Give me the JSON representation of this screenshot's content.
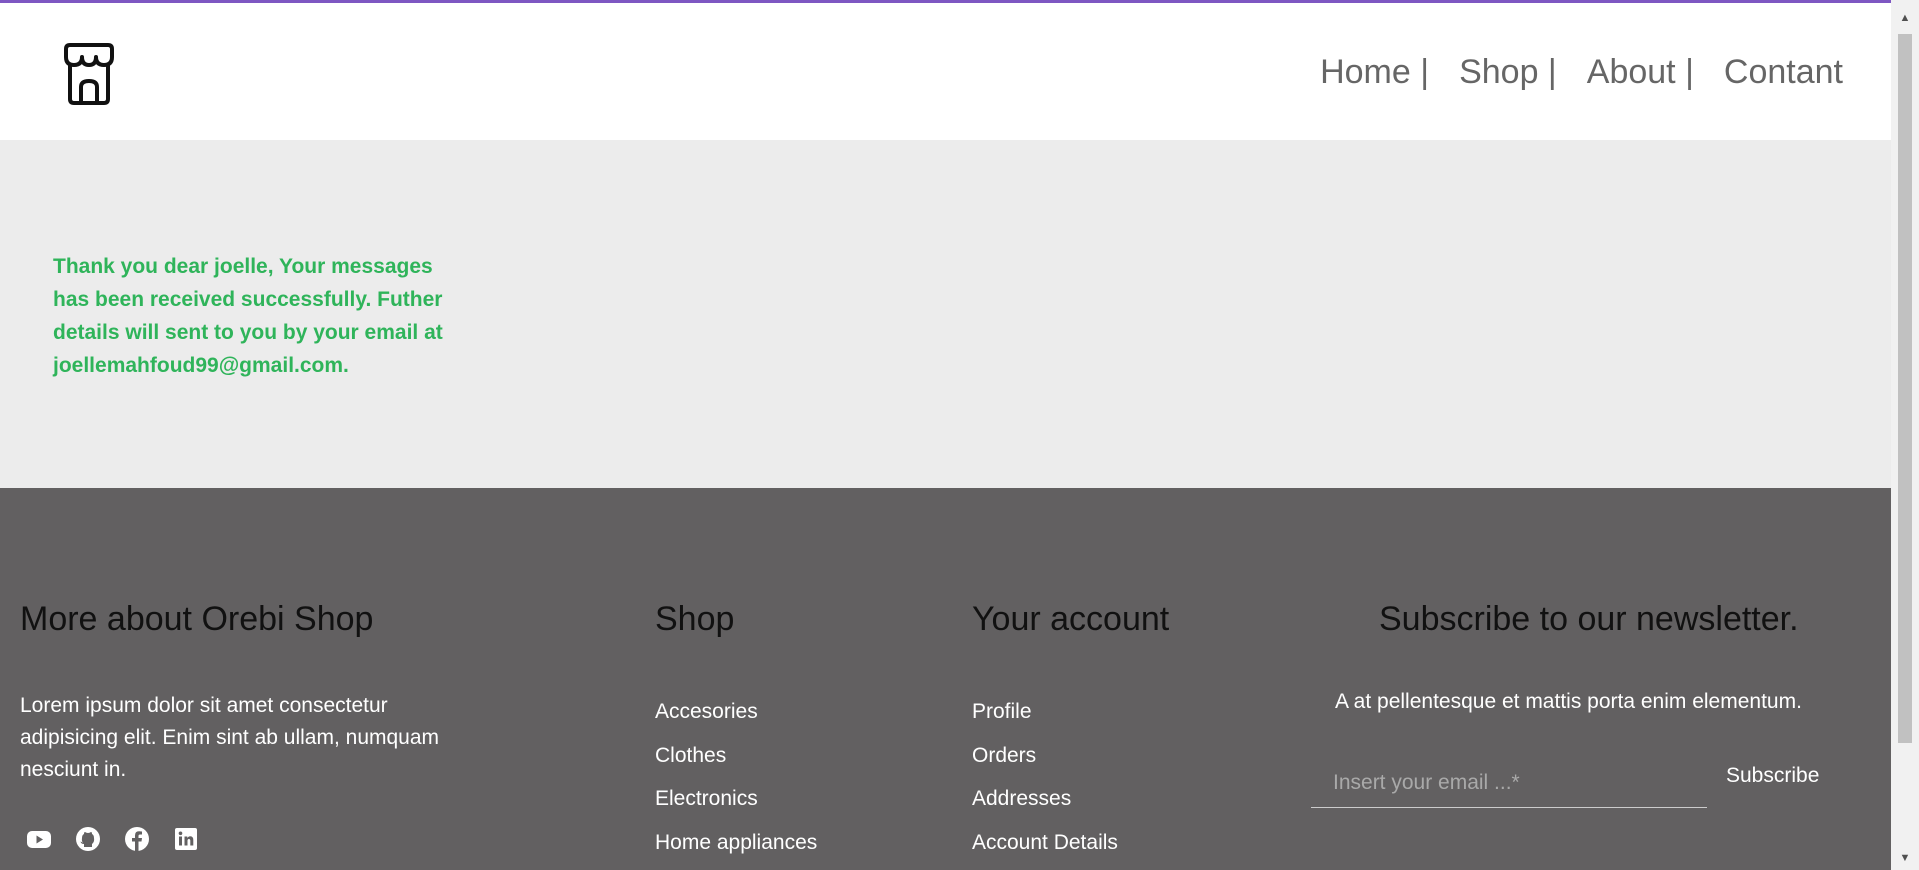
{
  "header": {
    "logo_icon": "storefront-icon",
    "nav": [
      {
        "label": "Home |"
      },
      {
        "label": "Shop |"
      },
      {
        "label": "About |"
      },
      {
        "label": "Contant"
      }
    ]
  },
  "main": {
    "message": "Thank you dear joelle, Your messages has been received successfully. Futher details will sent to you by your email at joellemahfoud99@gmail.com.",
    "message_color": "#2fb45a",
    "background": "#ececec"
  },
  "footer": {
    "background": "#626061",
    "about": {
      "title": "More about Orebi Shop",
      "text": "Lorem ipsum dolor sit amet consectetur adipisicing elit. Enim sint ab ullam, numquam nesciunt in.",
      "socials": [
        "youtube-icon",
        "github-icon",
        "facebook-icon",
        "linkedin-icon"
      ]
    },
    "shop": {
      "title": "Shop",
      "links": [
        "Accesories",
        "Clothes",
        "Electronics",
        "Home appliances"
      ]
    },
    "account": {
      "title": "Your account",
      "links": [
        "Profile",
        "Orders",
        "Addresses",
        "Account Details"
      ]
    },
    "newsletter": {
      "title": "Subscribe to our newsletter.",
      "description": "A at pellentesque et mattis porta enim elementum.",
      "email_placeholder": "Insert your email ...*",
      "email_value": "",
      "button_label": "Subscribe"
    }
  },
  "colors": {
    "accent_top_line": "#7e57c2"
  }
}
